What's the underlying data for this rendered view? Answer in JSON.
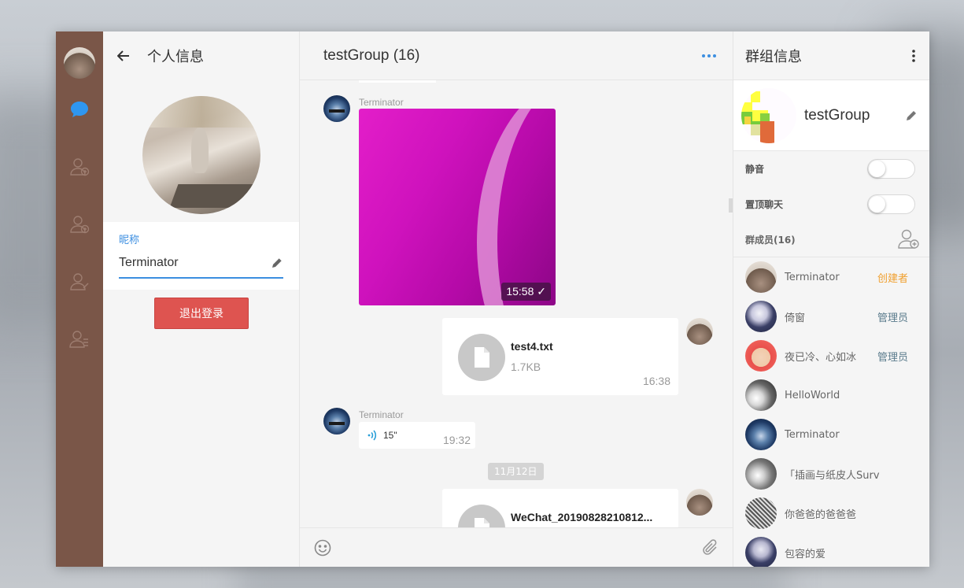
{
  "profile": {
    "title": "个人信息",
    "nickname_label": "昵称",
    "nickname_value": "Terminator",
    "logout_label": "退出登录"
  },
  "chat": {
    "title": "testGroup (16)",
    "messages": {
      "m1": {
        "sender": "Terminator",
        "image_time": "15:58"
      },
      "m2": {
        "file_name": "test4.txt",
        "file_size": "1.7KB",
        "time": "16:38"
      },
      "m3": {
        "sender": "Terminator",
        "voice_duration": "15\"",
        "time": "19:32"
      },
      "date_divider": "11月12日",
      "m4": {
        "file_name": "WeChat_20190828210812..."
      }
    }
  },
  "group": {
    "title": "群组信息",
    "name": "testGroup",
    "mute_label": "静音",
    "pin_label": "置顶聊天",
    "toggles": {
      "mute": false,
      "pin": false
    },
    "members_label": "群成员(16)",
    "members": [
      {
        "name": "Terminator",
        "role": "创建者"
      },
      {
        "name": "倚窗",
        "role": "管理员"
      },
      {
        "name": "夜已冷、心如冰",
        "role": "管理员"
      },
      {
        "name": "HelloWorld",
        "role": ""
      },
      {
        "name": "Terminator",
        "role": ""
      },
      {
        "name": "「插画与纸皮人Surv",
        "role": ""
      },
      {
        "name": "你爸爸的爸爸爸",
        "role": ""
      },
      {
        "name": "包容的爱",
        "role": ""
      }
    ]
  },
  "colors": {
    "rail": "#7a5648",
    "accent": "#3b8ee0",
    "danger": "#de5450",
    "owner": "#f0a030"
  },
  "icons": [
    "back-arrow-icon",
    "chat-bubble-icon",
    "contacts-icon",
    "add-user-icon",
    "user-icon",
    "user-list-icon",
    "more-dots-icon",
    "pencil-icon",
    "file-icon",
    "voice-icon",
    "emoji-icon",
    "paperclip-icon",
    "kebab-menu-icon",
    "add-member-icon"
  ]
}
